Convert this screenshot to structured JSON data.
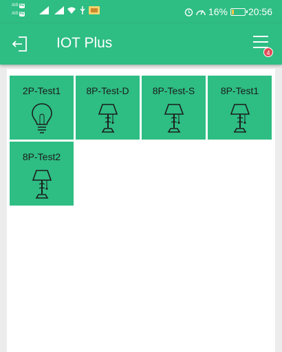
{
  "status_bar": {
    "sim1": "AIS",
    "sim1_net": "4G",
    "sim2": "AIS",
    "sim2_net": "4G",
    "battery_percent": "16%",
    "battery_level": 0.16,
    "time": "20:56"
  },
  "app_bar": {
    "title": "IOT Plus",
    "notification_count": "4"
  },
  "devices": [
    {
      "name": "2P-Test1",
      "icon": "bulb-icon"
    },
    {
      "name": "8P-Test-D",
      "icon": "lamp-icon"
    },
    {
      "name": "8P-Test-S",
      "icon": "lamp-icon"
    },
    {
      "name": "8P-Test1",
      "icon": "lamp-icon"
    },
    {
      "name": "8P-Test2",
      "icon": "lamp-icon"
    }
  ],
  "colors": {
    "primary": "#2ebd83",
    "badge": "#e04a55"
  }
}
